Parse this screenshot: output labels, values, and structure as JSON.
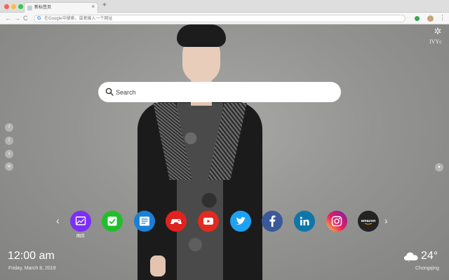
{
  "browser": {
    "tab_title": "新标签页",
    "tab_close": "×",
    "new_tab": "+",
    "address_placeholder": "在Google中搜索，或者输入一个网址",
    "google_glyph": "G",
    "back_glyph": "←",
    "forward_glyph": "→",
    "reload_glyph": "C",
    "menu_glyph": "⋮"
  },
  "brand": {
    "mark_glyph": "✲",
    "text": "IVYc"
  },
  "search": {
    "placeholder": "Search"
  },
  "social_rail": [
    {
      "icon": "facebook-icon",
      "glyph": "f"
    },
    {
      "icon": "twitter-icon",
      "glyph": "t"
    },
    {
      "icon": "snapchat-icon",
      "glyph": "s"
    },
    {
      "icon": "wechat-icon",
      "glyph": "w"
    }
  ],
  "right_rail_glyph": "●",
  "dock": {
    "prev_glyph": "‹",
    "next_glyph": "›",
    "apps": [
      {
        "name": "gallery",
        "label": "图库",
        "color": "#7b2ff7"
      },
      {
        "name": "tasks",
        "color": "#1fbf2a"
      },
      {
        "name": "notes",
        "color": "#1a7fd6"
      },
      {
        "name": "games",
        "color": "#e0231f"
      },
      {
        "name": "youtube",
        "color": "#e32a1f"
      },
      {
        "name": "twitter",
        "color": "#1da1f2"
      },
      {
        "name": "facebook",
        "color": "#3b5998"
      },
      {
        "name": "linkedin",
        "color": "#0e76a8"
      },
      {
        "name": "instagram",
        "color": "#d6249f"
      },
      {
        "name": "amazon",
        "color": "#232323",
        "wordmark": "amazon"
      }
    ]
  },
  "clock": {
    "time": "12:00 am",
    "date": "Friday, March 8, 2019"
  },
  "weather": {
    "temperature": "24°",
    "city": "Chongqing"
  }
}
